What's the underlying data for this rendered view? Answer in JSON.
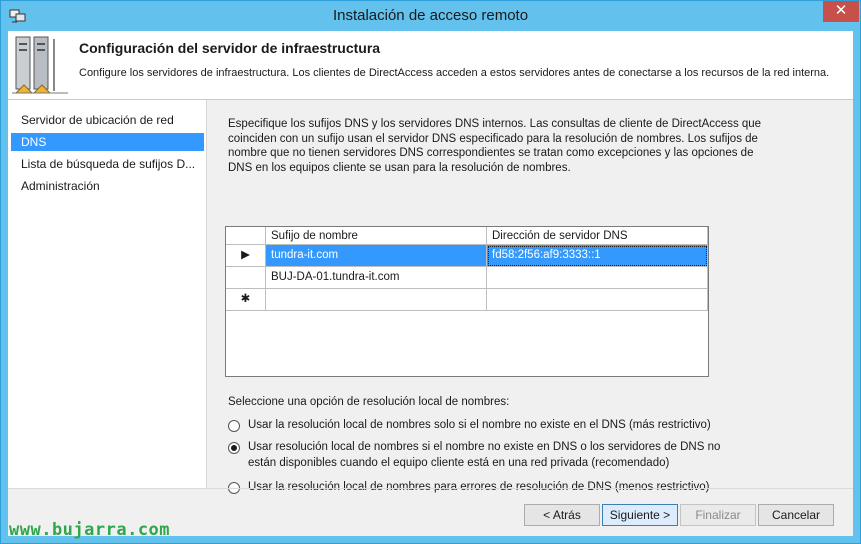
{
  "window": {
    "title": "Instalación de acceso remoto",
    "close_symbol": "✕",
    "app_icon": "remote-access-icon"
  },
  "header": {
    "title": "Configuración del servidor de infraestructura",
    "description": "Configure los servidores de infraestructura. Los clientes de DirectAccess acceden a estos servidores antes de conectarse a los recursos de la red interna.",
    "icon": "server-infrastructure-icon"
  },
  "nav": {
    "items": [
      {
        "label": "Servidor de ubicación de red",
        "selected": false
      },
      {
        "label": "DNS",
        "selected": true
      },
      {
        "label": "Lista de búsqueda de sufijos D...",
        "selected": false
      },
      {
        "label": "Administración",
        "selected": false
      }
    ]
  },
  "content": {
    "intro": "Especifique los sufijos DNS y los servidores DNS internos. Las consultas de cliente de DirectAccess que coinciden con un sufijo usan el servidor DNS especificado para la resolución de nombres. Los sufijos de nombre que no tienen servidores DNS correspondientes se tratan como excepciones y las opciones de DNS en los equipos cliente se usan para la resolución de nombres.",
    "grid": {
      "columns": [
        "Sufijo de nombre",
        "Dirección de servidor DNS"
      ],
      "rows": [
        {
          "marker": "▶",
          "suffix": "tundra-it.com",
          "dns": "fd58:2f56:af9:3333::1",
          "selected": true
        },
        {
          "marker": "",
          "suffix": "BUJ-DA-01.tundra-it.com",
          "dns": "",
          "selected": false
        },
        {
          "marker": "✱",
          "suffix": "",
          "dns": "",
          "selected": false
        }
      ]
    },
    "options_title": "Seleccione una opción de resolución local de nombres:",
    "options": [
      {
        "label": "Usar la resolución local de nombres solo si el nombre no existe en el DNS (más restrictivo)",
        "checked": false
      },
      {
        "label": "Usar resolución local de nombres si el nombre no existe en DNS o los servidores de DNS no están disponibles cuando el equipo cliente está en una red privada (recomendado)",
        "checked": true
      },
      {
        "label": "Usar la resolución local de nombres para errores de resolución de DNS (menos restrictivo)",
        "checked": false
      }
    ]
  },
  "buttons": {
    "back": "< Atrás",
    "next": "Siguiente >",
    "finish": "Finalizar",
    "cancel": "Cancelar"
  },
  "watermark": "www.bujarra.com",
  "colors": {
    "titlebar": "#63c1ee",
    "selection": "#3399ff",
    "close": "#c7504a",
    "watermark": "#2ea84a"
  }
}
